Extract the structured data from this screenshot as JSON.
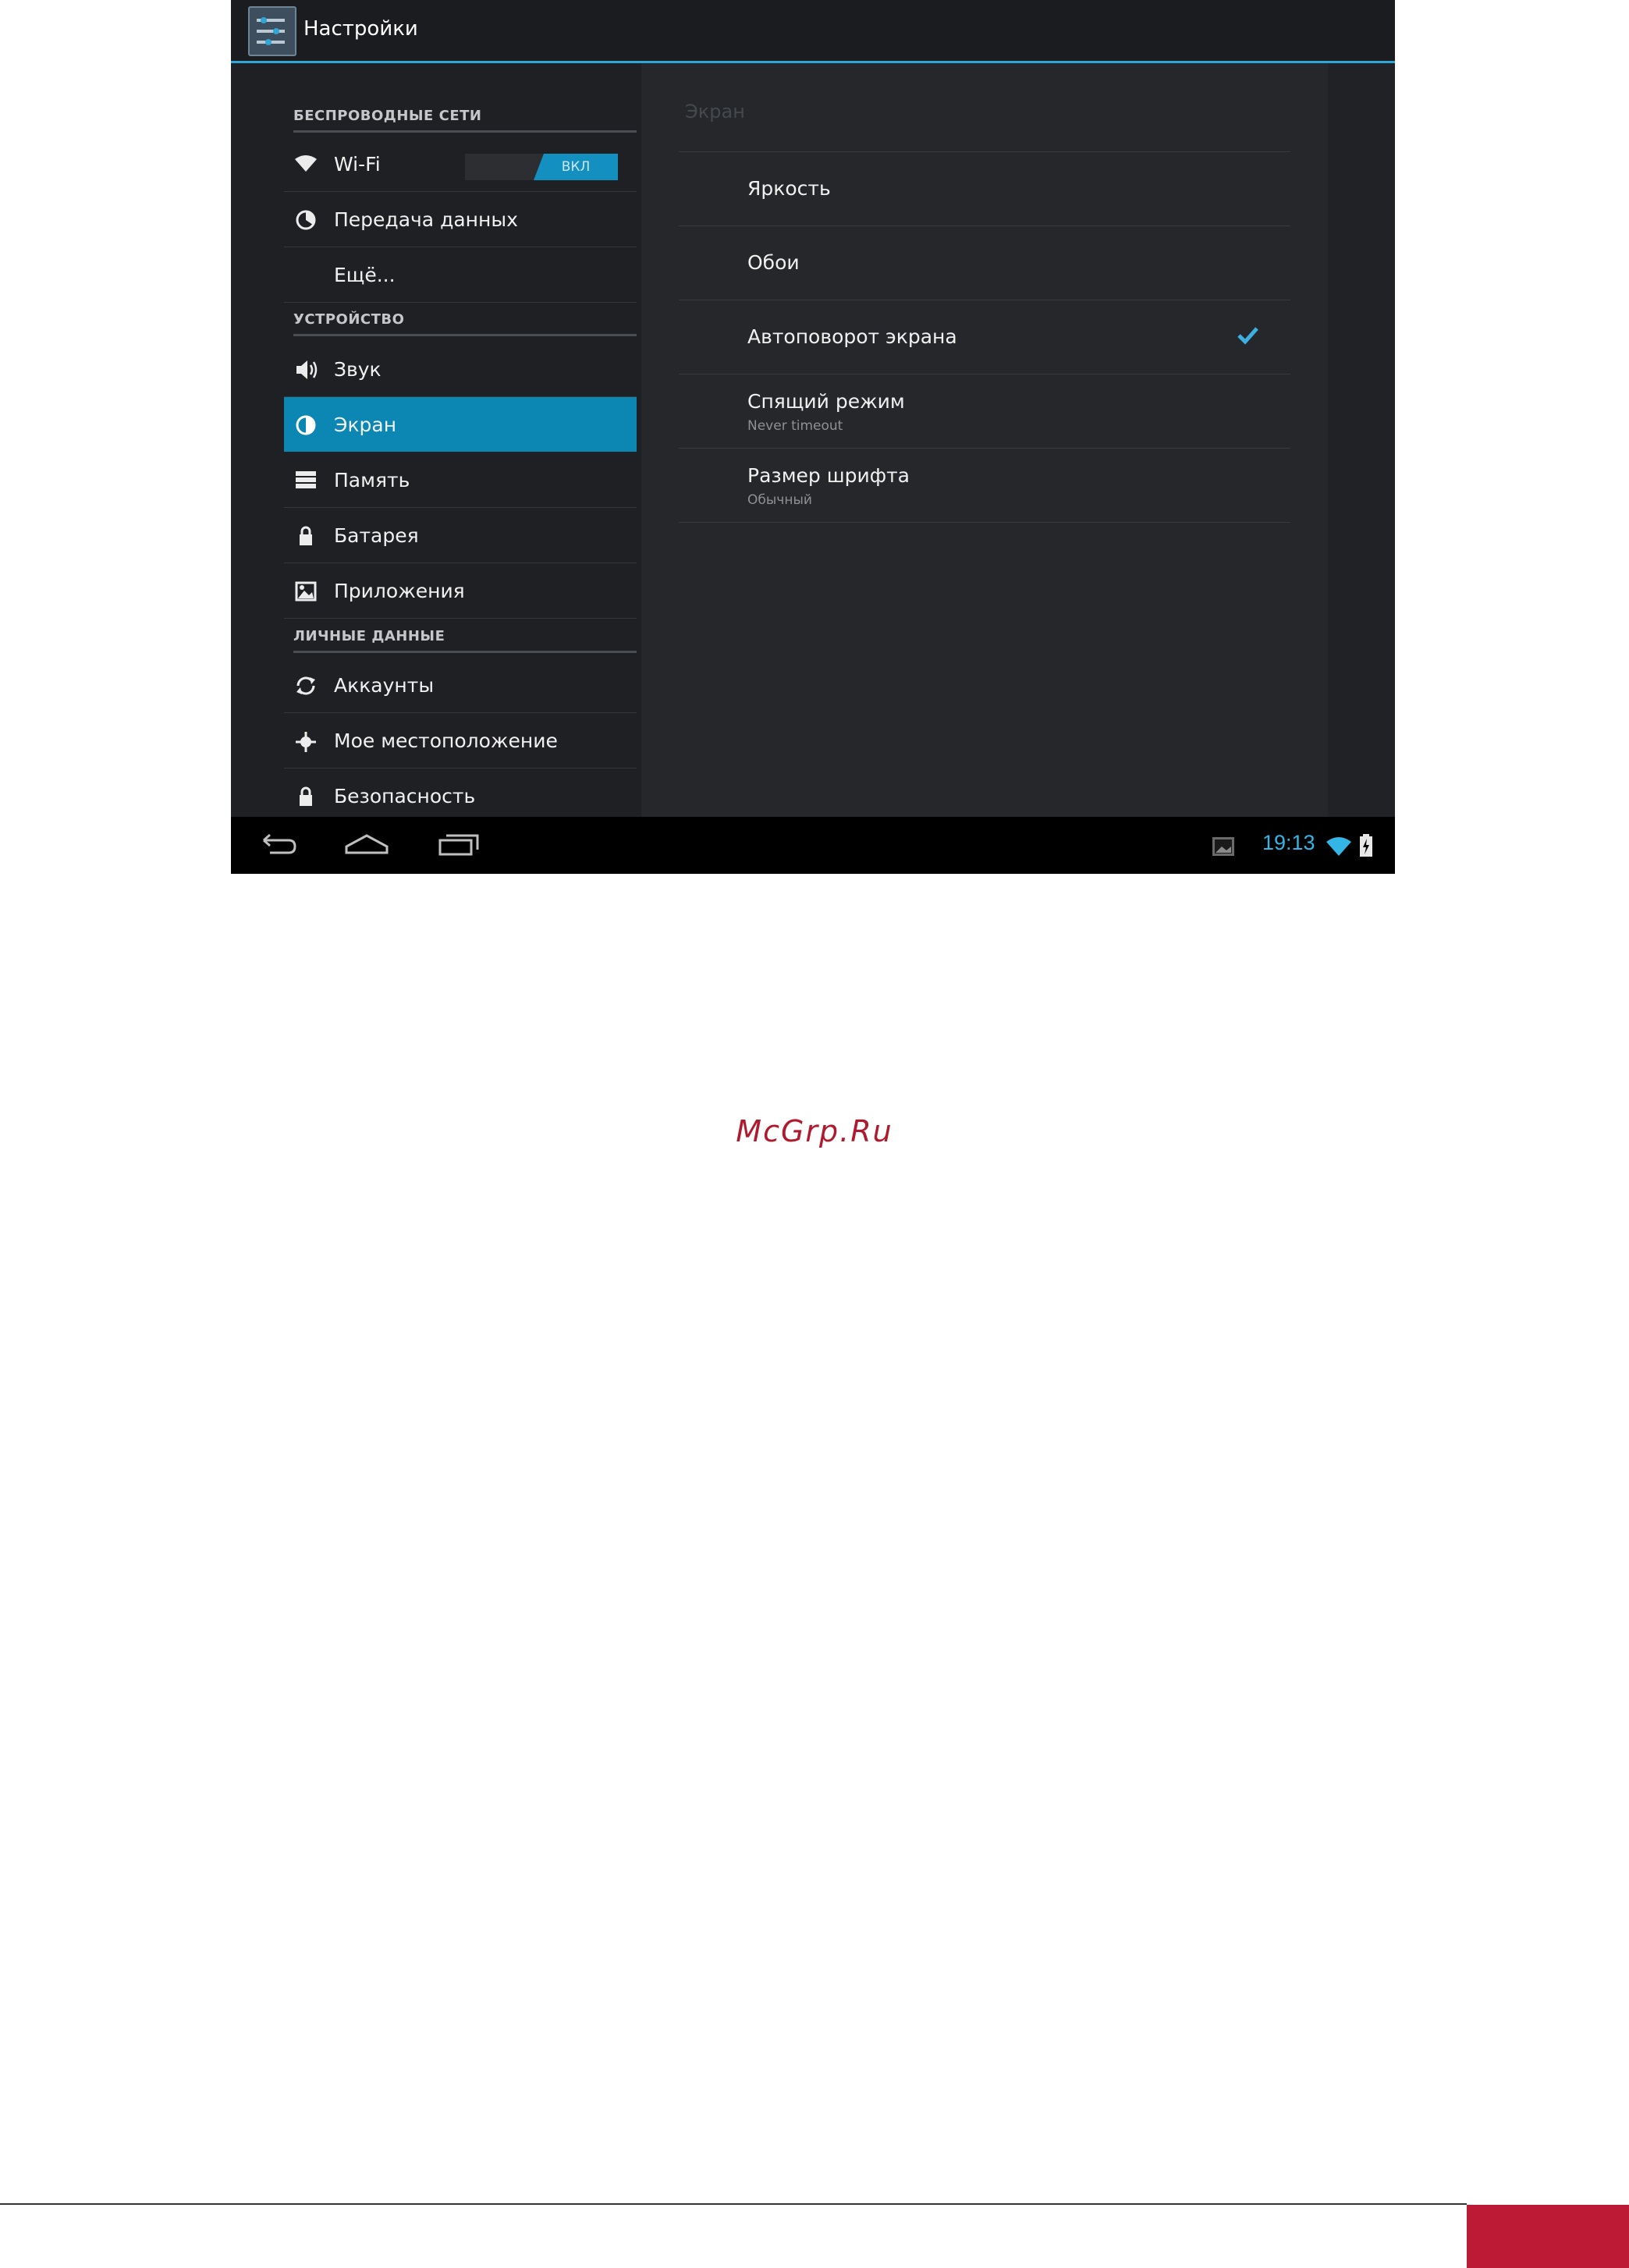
{
  "app": {
    "title": "Настройки",
    "accent_color": "#33b5e5",
    "selected_color": "#0c86b3"
  },
  "sidebar": {
    "sections": [
      {
        "header": "БЕСПРОВОДНЫЕ СЕТИ",
        "items": [
          {
            "label": "Wi-Fi",
            "icon": "wifi-icon",
            "toggle": "ВКЛ"
          },
          {
            "label": "Передача данных",
            "icon": "data-usage-icon"
          },
          {
            "label": "Ещё...",
            "icon": ""
          }
        ]
      },
      {
        "header": "УСТРОЙСТВО",
        "items": [
          {
            "label": "Звук",
            "icon": "speaker-icon"
          },
          {
            "label": "Экран",
            "icon": "display-icon",
            "selected": true
          },
          {
            "label": "Память",
            "icon": "storage-icon"
          },
          {
            "label": "Батарея",
            "icon": "battery-icon"
          },
          {
            "label": "Приложения",
            "icon": "apps-icon"
          }
        ]
      },
      {
        "header": "ЛИЧНЫЕ ДАННЫЕ",
        "items": [
          {
            "label": "Аккаунты",
            "icon": "sync-icon"
          },
          {
            "label": "Мое местоположение",
            "icon": "location-icon"
          },
          {
            "label": "Безопасность",
            "icon": "lock-icon"
          }
        ]
      }
    ]
  },
  "display": {
    "title": "Экран",
    "items": [
      {
        "title": "Яркость",
        "summary": ""
      },
      {
        "title": "Обои",
        "summary": ""
      },
      {
        "title": "Автоповорот экрана",
        "summary": "",
        "checked": true
      },
      {
        "title": "Спящий режим",
        "summary": "Never timeout"
      },
      {
        "title": "Размер шрифта",
        "summary": "Обычный"
      }
    ]
  },
  "status_bar": {
    "time": "19:13",
    "icons": [
      "back-icon",
      "home-icon",
      "recent-apps-icon",
      "screenshot-icon",
      "wifi-signal-icon",
      "battery-charging-icon"
    ]
  },
  "watermark": "McGrp.Ru",
  "footer_color": "#bd1a36"
}
